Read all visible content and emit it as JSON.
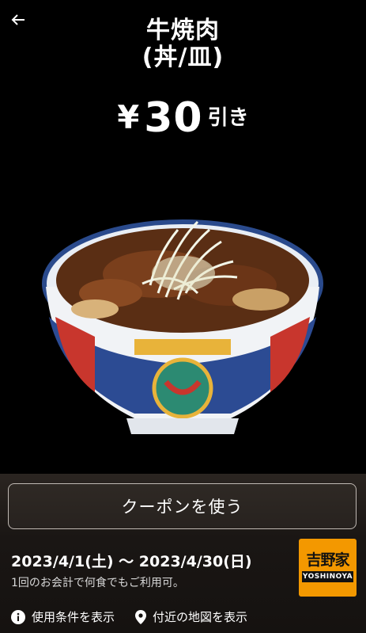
{
  "header": {
    "title_line1": "牛焼肉",
    "title_line2": "(丼/皿)",
    "price_symbol": "¥",
    "price_amount": "30",
    "price_suffix": "引き"
  },
  "coupon": {
    "use_button": "クーポンを使う",
    "period": "2023/4/1(土) 〜 2023/4/30(日)",
    "note": "1回のお会計で何食でもご利用可。"
  },
  "brand": {
    "logo_kanji": "吉野家",
    "logo_roman": "YOSHINOYA",
    "logo_color": "#f39800"
  },
  "links": {
    "terms": "使用条件を表示",
    "map": "付近の地図を表示"
  },
  "icons": {
    "back": "arrow-left-icon",
    "info": "info-icon",
    "location": "location-pin-icon"
  }
}
